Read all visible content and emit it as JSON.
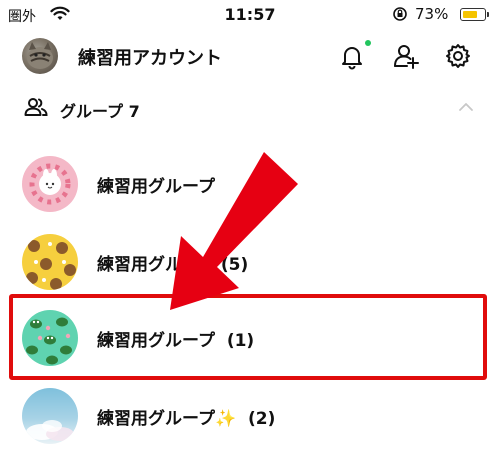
{
  "status": {
    "carrier": "圏外",
    "time": "11:57",
    "battery_percent": "73%",
    "battery_level": 0.73
  },
  "profile": {
    "name": "練習用アカウント"
  },
  "icons": [
    "bell-icon",
    "add-friend-icon",
    "gear-icon",
    "group-icon",
    "chevron-up-icon",
    "wifi-icon",
    "rotation-lock-icon",
    "battery-icon"
  ],
  "groups_section": {
    "title": "グループ 7"
  },
  "groups": [
    {
      "name": "練習用グループ"
    },
    {
      "name": "練習用グループ (5)"
    },
    {
      "name": "練習用グループ  (1)"
    },
    {
      "name": "練習用グループ✨  (2)"
    }
  ],
  "colors": {
    "highlight": "#e00c0c",
    "arrow": "#e60012",
    "notification_dot": "#22c55e",
    "battery": "#f5c400"
  }
}
